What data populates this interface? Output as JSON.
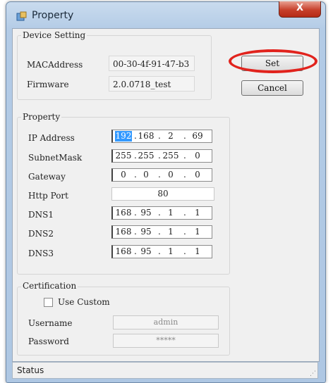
{
  "window": {
    "title": "Property",
    "close_glyph": "X"
  },
  "device_setting": {
    "legend": "Device Setting",
    "mac_label": "MACAddress",
    "mac_value": "00-30-4f-91-47-b3",
    "firmware_label": "Firmware",
    "firmware_value": "2.0.0718_test"
  },
  "buttons": {
    "set": "Set",
    "cancel": "Cancel"
  },
  "property": {
    "legend": "Property",
    "ip_label": "IP Address",
    "ip": [
      "192",
      "168",
      "2",
      "69"
    ],
    "subnet_label": "SubnetMask",
    "subnet": [
      "255",
      "255",
      "255",
      "0"
    ],
    "gateway_label": "Gateway",
    "gateway": [
      "0",
      "0",
      "0",
      "0"
    ],
    "http_label": "Http Port",
    "http_port": "80",
    "dns1_label": "DNS1",
    "dns1": [
      "168",
      "95",
      "1",
      "1"
    ],
    "dns2_label": "DNS2",
    "dns2": [
      "168",
      "95",
      "1",
      "1"
    ],
    "dns3_label": "DNS3",
    "dns3": [
      "168",
      "95",
      "1",
      "1"
    ]
  },
  "certification": {
    "legend": "Certification",
    "use_custom_label": "Use Custom",
    "use_custom_checked": false,
    "username_label": "Username",
    "username_value": "admin",
    "password_label": "Password",
    "password_value": "*****"
  },
  "status": {
    "text": "Status"
  },
  "colors": {
    "highlight_oval": "#e1231d",
    "selection": "#3399ff"
  }
}
